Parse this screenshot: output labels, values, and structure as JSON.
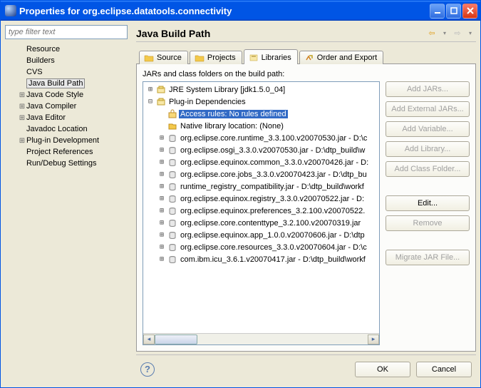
{
  "window": {
    "title": "Properties for org.eclipse.datatools.connectivity"
  },
  "filter": {
    "placeholder": "type filter text"
  },
  "nav": {
    "items": [
      {
        "label": "Resource",
        "expandable": false
      },
      {
        "label": "Builders",
        "expandable": false
      },
      {
        "label": "CVS",
        "expandable": false
      },
      {
        "label": "Java Build Path",
        "expandable": false,
        "selected": true
      },
      {
        "label": "Java Code Style",
        "expandable": true
      },
      {
        "label": "Java Compiler",
        "expandable": true
      },
      {
        "label": "Java Editor",
        "expandable": true
      },
      {
        "label": "Javadoc Location",
        "expandable": false
      },
      {
        "label": "Plug-in Development",
        "expandable": true
      },
      {
        "label": "Project References",
        "expandable": false
      },
      {
        "label": "Run/Debug Settings",
        "expandable": false
      }
    ]
  },
  "page": {
    "title": "Java Build Path"
  },
  "tabs": {
    "items": [
      {
        "label": "Source"
      },
      {
        "label": "Projects"
      },
      {
        "label": "Libraries",
        "active": true
      },
      {
        "label": "Order and Export"
      }
    ]
  },
  "libraries": {
    "header": "JARs and class folders on the build path:",
    "tree": [
      {
        "depth": 0,
        "twisty": "+",
        "icon": "lib",
        "text": "JRE System Library [jdk1.5.0_04]"
      },
      {
        "depth": 0,
        "twisty": "-",
        "icon": "lib",
        "text": "Plug-in Dependencies"
      },
      {
        "depth": 1,
        "twisty": "",
        "icon": "access",
        "text": "Access rules: No rules defined",
        "selected": true
      },
      {
        "depth": 1,
        "twisty": "",
        "icon": "native",
        "text": "Native library location: (None)"
      },
      {
        "depth": 1,
        "twisty": "+",
        "icon": "jar",
        "text": "org.eclipse.core.runtime_3.3.100.v20070530.jar - D:\\c"
      },
      {
        "depth": 1,
        "twisty": "+",
        "icon": "jar",
        "text": "org.eclipse.osgi_3.3.0.v20070530.jar - D:\\dtp_build\\w"
      },
      {
        "depth": 1,
        "twisty": "+",
        "icon": "jar",
        "text": "org.eclipse.equinox.common_3.3.0.v20070426.jar - D:"
      },
      {
        "depth": 1,
        "twisty": "+",
        "icon": "jar",
        "text": "org.eclipse.core.jobs_3.3.0.v20070423.jar - D:\\dtp_bu"
      },
      {
        "depth": 1,
        "twisty": "+",
        "icon": "jar",
        "text": "runtime_registry_compatibility.jar - D:\\dtp_build\\workf"
      },
      {
        "depth": 1,
        "twisty": "+",
        "icon": "jar",
        "text": "org.eclipse.equinox.registry_3.3.0.v20070522.jar - D:"
      },
      {
        "depth": 1,
        "twisty": "+",
        "icon": "jar",
        "text": "org.eclipse.equinox.preferences_3.2.100.v20070522."
      },
      {
        "depth": 1,
        "twisty": "+",
        "icon": "jar",
        "text": "org.eclipse.core.contenttype_3.2.100.v20070319.jar"
      },
      {
        "depth": 1,
        "twisty": "+",
        "icon": "jar",
        "text": "org.eclipse.equinox.app_1.0.0.v20070606.jar - D:\\dtp"
      },
      {
        "depth": 1,
        "twisty": "+",
        "icon": "jar",
        "text": "org.eclipse.core.resources_3.3.0.v20070604.jar - D:\\c"
      },
      {
        "depth": 1,
        "twisty": "+",
        "icon": "jar",
        "text": "com.ibm.icu_3.6.1.v20070417.jar - D:\\dtp_build\\workf"
      }
    ]
  },
  "buttons": {
    "addJars": "Add JARs...",
    "addExternal": "Add External JARs...",
    "addVariable": "Add Variable...",
    "addLibrary": "Add Library...",
    "addClassFolder": "Add Class Folder...",
    "edit": "Edit...",
    "remove": "Remove",
    "migrate": "Migrate JAR File..."
  },
  "footer": {
    "ok": "OK",
    "cancel": "Cancel"
  }
}
